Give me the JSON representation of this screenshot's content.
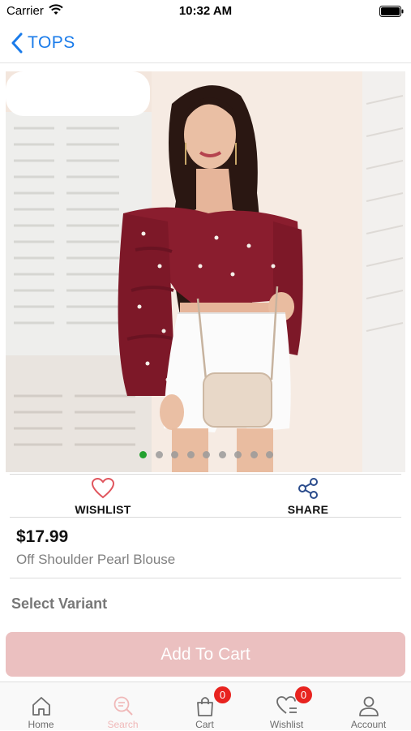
{
  "status_bar": {
    "carrier": "Carrier",
    "time": "10:32 AM"
  },
  "nav": {
    "back_label": "TOPS"
  },
  "gallery": {
    "image_count": 9,
    "active_index": 0
  },
  "actions": {
    "wishlist_label": "WISHLIST",
    "share_label": "SHARE"
  },
  "product": {
    "price": "$17.99",
    "name": "Off Shoulder Pearl Blouse"
  },
  "variant": {
    "title": "Select Variant"
  },
  "cart_button": {
    "label": "Add To Cart"
  },
  "tab_bar": {
    "tabs": [
      {
        "label": "Home",
        "icon": "home-icon"
      },
      {
        "label": "Search",
        "icon": "search-icon"
      },
      {
        "label": "Cart",
        "icon": "cart-icon",
        "badge": "0"
      },
      {
        "label": "Wishlist",
        "icon": "wishlist-icon",
        "badge": "0"
      },
      {
        "label": "Account",
        "icon": "account-icon"
      }
    ],
    "active": "Search"
  },
  "colors": {
    "accent": "#1a7bea",
    "button": "#ebc0c0",
    "badge": "#e8231f",
    "active_dot": "#23a12f",
    "blouse": "#8a1d2e"
  }
}
